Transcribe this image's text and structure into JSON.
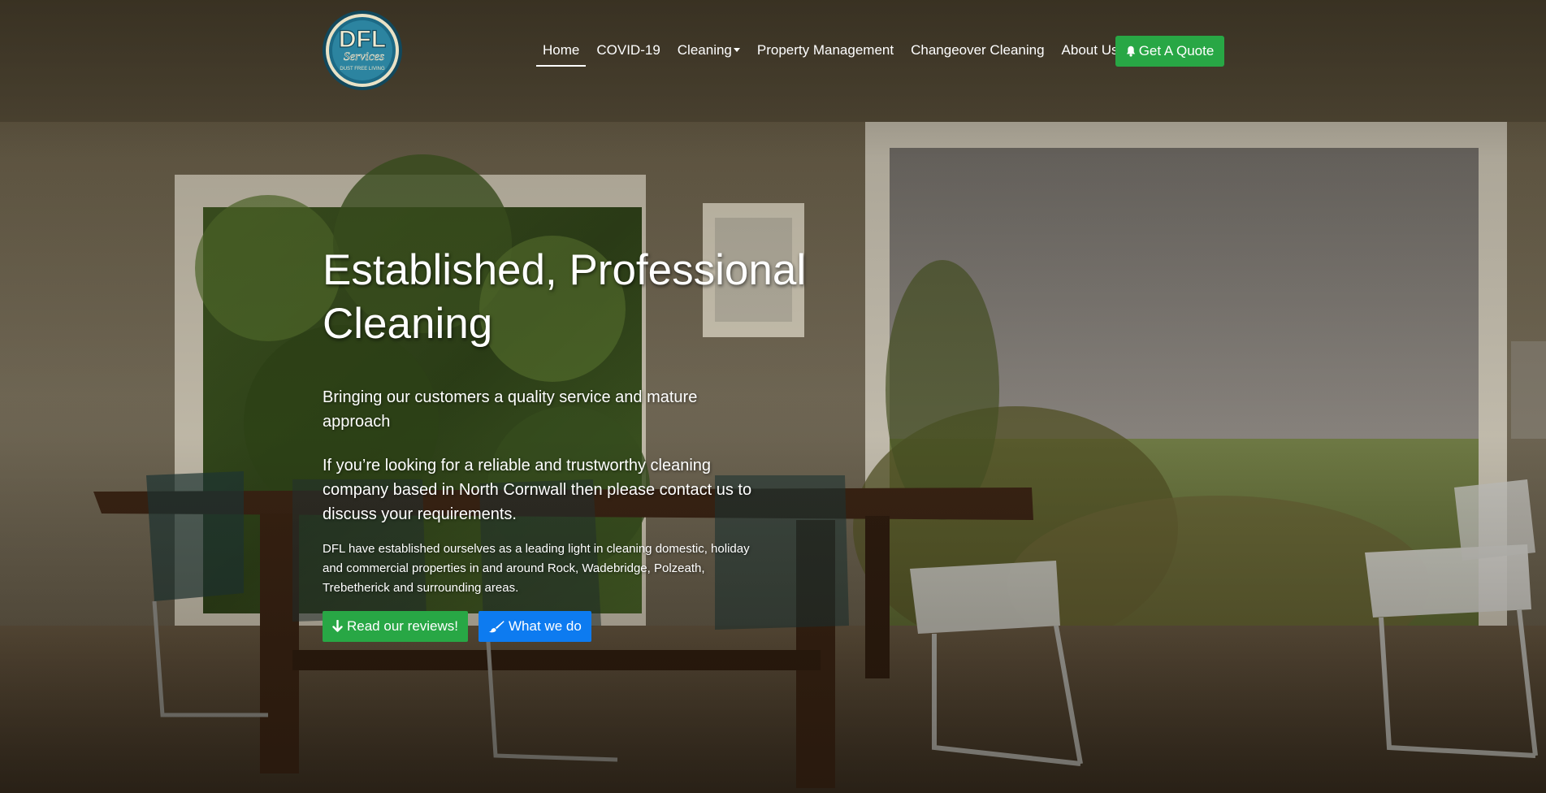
{
  "logo": {
    "line1": "DFL",
    "line2": "Services",
    "tagline": "DUST FREE LIVING"
  },
  "nav": {
    "items": [
      {
        "label": "Home",
        "active": true
      },
      {
        "label": "COVID-19"
      },
      {
        "label": "Cleaning",
        "dropdown": true
      },
      {
        "label": "Property Management"
      },
      {
        "label": "Changeover Cleaning"
      },
      {
        "label": "About Us"
      }
    ],
    "quote_label": "Get A Quote",
    "quote_icon": "bell-icon"
  },
  "hero": {
    "title": "Established, Professional Cleaning",
    "lead1": "Bringing our customers a quality service and mature approach",
    "lead2": "If you’re looking for a reliable and trustworthy cleaning company based in North Cornwall then please contact us to discuss your requirements.",
    "body": "DFL have established ourselves as a leading light in cleaning domestic, holiday and commercial properties in and around Rock, Wadebridge, Polzeath, Trebetherick and surrounding areas.",
    "reviews_label": "Read our reviews!",
    "reviews_icon": "arrow-down-icon",
    "whatwedo_label": "What we do",
    "whatwedo_icon": "paintbrush-icon"
  },
  "colors": {
    "green": "#28a745",
    "blue": "#0d7bf0",
    "logo_teal": "#1c6a86",
    "logo_cream": "#e9e2c6"
  }
}
